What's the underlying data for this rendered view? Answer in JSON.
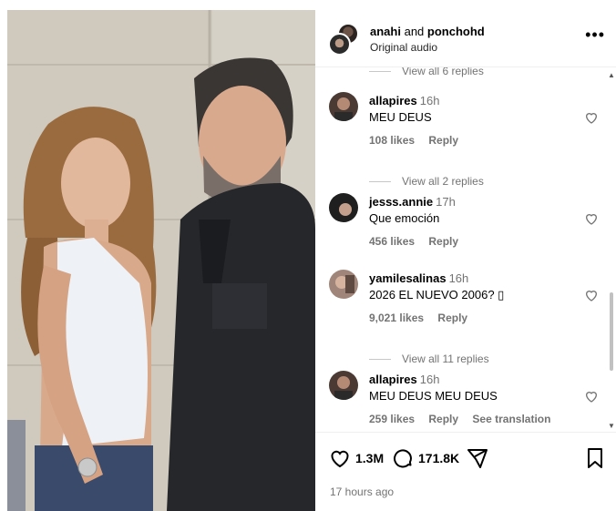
{
  "post": {
    "users_prefix": "anahi",
    "users_joiner": "and",
    "users_suffix": "ponchohd",
    "audio": "Original audio",
    "more": "•••"
  },
  "comments_panel": {
    "top_replies": "View all 6 replies",
    "items": [
      {
        "user": "allapires",
        "time": "16h",
        "text": "MEU DEUS",
        "likes": "108 likes",
        "reply": "Reply",
        "extra": "",
        "replies": "View all 2 replies"
      },
      {
        "user": "jesss.annie",
        "time": "17h",
        "text": "Que emoción",
        "likes": "456 likes",
        "reply": "Reply",
        "extra": "",
        "replies": ""
      },
      {
        "user": "yamilesalinas",
        "time": "16h",
        "text": "2026 EL NUEVO 2006? ▯",
        "likes": "9,021 likes",
        "reply": "Reply",
        "extra": "",
        "replies": "View all 11 replies"
      },
      {
        "user": "allapires",
        "time": "16h",
        "text": "MEU DEUS MEU DEUS",
        "likes": "259 likes",
        "reply": "Reply",
        "extra": "See translation",
        "replies": ""
      }
    ]
  },
  "actions": {
    "like_count": "1.3M",
    "comment_count": "171.8K",
    "posted": "17 hours ago",
    "icons": [
      "heart-icon",
      "comment-icon",
      "share-icon",
      "bookmark-icon"
    ]
  },
  "colors": {
    "muted": "#737373",
    "divider": "#efefef"
  }
}
